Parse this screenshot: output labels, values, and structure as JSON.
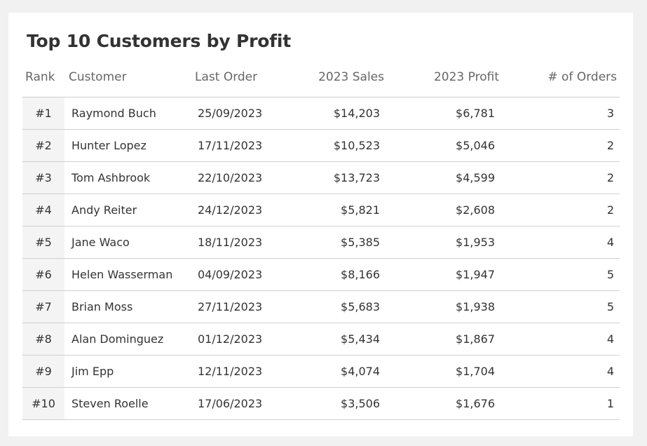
{
  "title": "Top 10 Customers by Profit",
  "columns": {
    "rank": "Rank",
    "customer": "Customer",
    "last_order": "Last Order",
    "sales": "2023 Sales",
    "profit": "2023 Profit",
    "orders": "# of Orders"
  },
  "rows": [
    {
      "rank": "#1",
      "customer": "Raymond Buch",
      "last_order": "25/09/2023",
      "sales": "$14,203",
      "profit": "$6,781",
      "orders": "3"
    },
    {
      "rank": "#2",
      "customer": "Hunter Lopez",
      "last_order": "17/11/2023",
      "sales": "$10,523",
      "profit": "$5,046",
      "orders": "2"
    },
    {
      "rank": "#3",
      "customer": "Tom Ashbrook",
      "last_order": "22/10/2023",
      "sales": "$13,723",
      "profit": "$4,599",
      "orders": "2"
    },
    {
      "rank": "#4",
      "customer": "Andy Reiter",
      "last_order": "24/12/2023",
      "sales": "$5,821",
      "profit": "$2,608",
      "orders": "2"
    },
    {
      "rank": "#5",
      "customer": "Jane Waco",
      "last_order": "18/11/2023",
      "sales": "$5,385",
      "profit": "$1,953",
      "orders": "4"
    },
    {
      "rank": "#6",
      "customer": "Helen Wasserman",
      "last_order": "04/09/2023",
      "sales": "$8,166",
      "profit": "$1,947",
      "orders": "5"
    },
    {
      "rank": "#7",
      "customer": "Brian Moss",
      "last_order": "27/11/2023",
      "sales": "$5,683",
      "profit": "$1,938",
      "orders": "5"
    },
    {
      "rank": "#8",
      "customer": "Alan Dominguez",
      "last_order": "01/12/2023",
      "sales": "$5,434",
      "profit": "$1,867",
      "orders": "4"
    },
    {
      "rank": "#9",
      "customer": "Jim Epp",
      "last_order": "12/11/2023",
      "sales": "$4,074",
      "profit": "$1,704",
      "orders": "4"
    },
    {
      "rank": "#10",
      "customer": "Steven Roelle",
      "last_order": "17/06/2023",
      "sales": "$3,506",
      "profit": "$1,676",
      "orders": "1"
    }
  ]
}
